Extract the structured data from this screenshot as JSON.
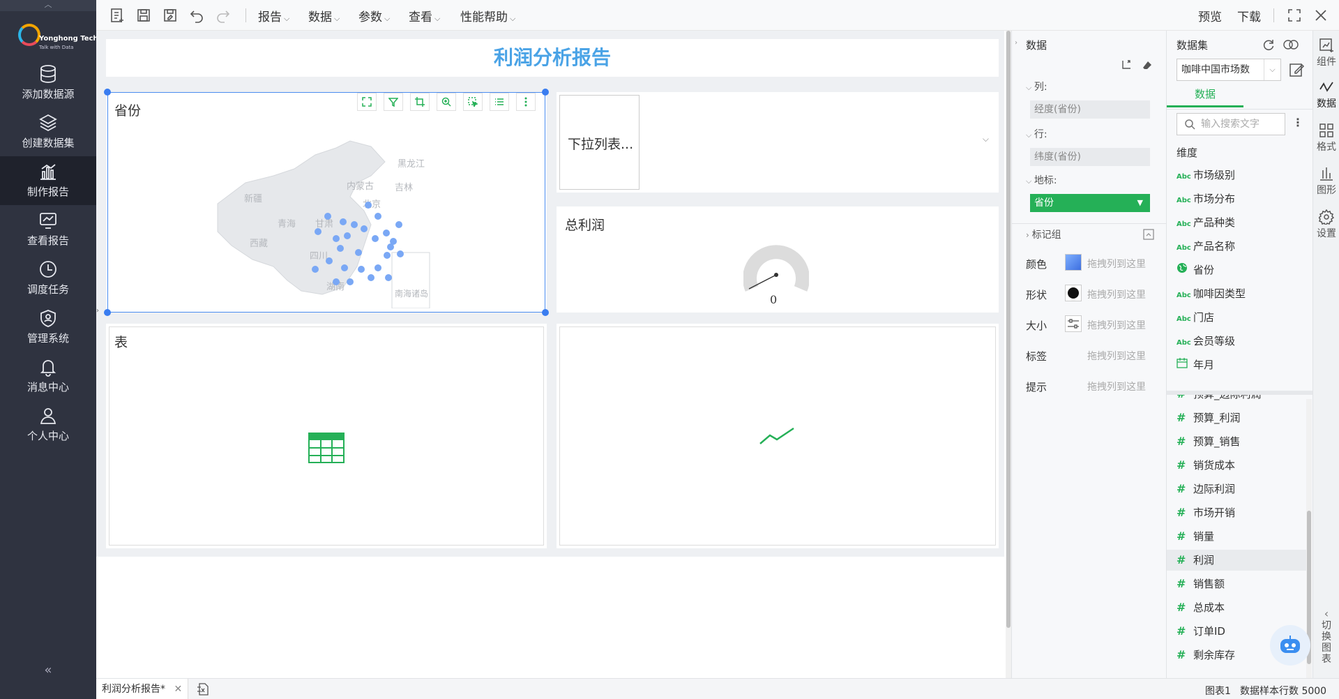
{
  "sidebar": {
    "logo": {
      "name": "Yonghong Tech",
      "tagline": "Talk with Data"
    },
    "items": [
      {
        "label": "添加数据源",
        "icon": "database-icon"
      },
      {
        "label": "创建数据集",
        "icon": "layers-icon"
      },
      {
        "label": "制作报告",
        "icon": "bar-chart-icon",
        "active": true
      },
      {
        "label": "查看报告",
        "icon": "line-monitor-icon"
      },
      {
        "label": "调度任务",
        "icon": "clock-icon"
      },
      {
        "label": "管理系统",
        "icon": "shield-icon"
      },
      {
        "label": "消息中心",
        "icon": "bell-icon"
      },
      {
        "label": "个人中心",
        "icon": "user-icon"
      }
    ]
  },
  "toolbar": {
    "menus": [
      "报告",
      "数据",
      "参数",
      "查看",
      "性能帮助"
    ],
    "preview": "预览",
    "download": "下载"
  },
  "report": {
    "title": "利润分析报告",
    "map_panel": {
      "title": "省份",
      "labels": [
        "黑龙江",
        "内蒙古",
        "吉林",
        "北京",
        "新疆",
        "青海",
        "甘肃",
        "西藏",
        "四川",
        "湖南",
        "南海诸岛"
      ]
    },
    "dropdown_panel": {
      "label": "下拉列表..."
    },
    "gauge_panel": {
      "title": "总利润",
      "value": "0"
    },
    "table_panel": {
      "title": "表"
    }
  },
  "binding": {
    "header": "数据",
    "columns_label": "列:",
    "columns_value": "经度(省份)",
    "rows_label": "行:",
    "rows_value": "纬度(省份)",
    "geo_label": "地标:",
    "geo_value": "省份",
    "mark_group": "标记组",
    "marks": [
      {
        "label": "颜色",
        "hint": "拖拽列到这里"
      },
      {
        "label": "形状",
        "hint": "拖拽列到这里"
      },
      {
        "label": "大小",
        "hint": "拖拽列到这里"
      },
      {
        "label": "标签",
        "hint": "拖拽列到这里"
      },
      {
        "label": "提示",
        "hint": "拖拽列到这里"
      }
    ]
  },
  "dataset": {
    "header": "数据集",
    "selected": "咖啡中国市场数",
    "tab": "数据",
    "search_placeholder": "输入搜索文字",
    "dimension_header": "维度",
    "dimensions": [
      {
        "type": "Abc",
        "name": "市场级别"
      },
      {
        "type": "Abc",
        "name": "市场分布"
      },
      {
        "type": "Abc",
        "name": "产品种类"
      },
      {
        "type": "Abc",
        "name": "产品名称"
      },
      {
        "type": "geo",
        "name": "省份"
      },
      {
        "type": "Abc",
        "name": "咖啡因类型"
      },
      {
        "type": "Abc",
        "name": "门店"
      },
      {
        "type": "Abc",
        "name": "会员等级"
      },
      {
        "type": "date",
        "name": "年月"
      }
    ],
    "measures_partial": "预算_边际利润",
    "measures": [
      "预算_利润",
      "预算_销售",
      "销货成本",
      "边际利润",
      "市场开销",
      "销量",
      "利润",
      "销售额",
      "总成本",
      "订单ID",
      "剩余库存"
    ],
    "highlighted": "利润"
  },
  "rail": {
    "items": [
      "组件",
      "数据",
      "格式",
      "图形",
      "设置"
    ],
    "switch": "切换图表"
  },
  "status": {
    "tab": "利润分析报告*",
    "chart": "图表1",
    "rows": "数据样本行数 5000"
  }
}
